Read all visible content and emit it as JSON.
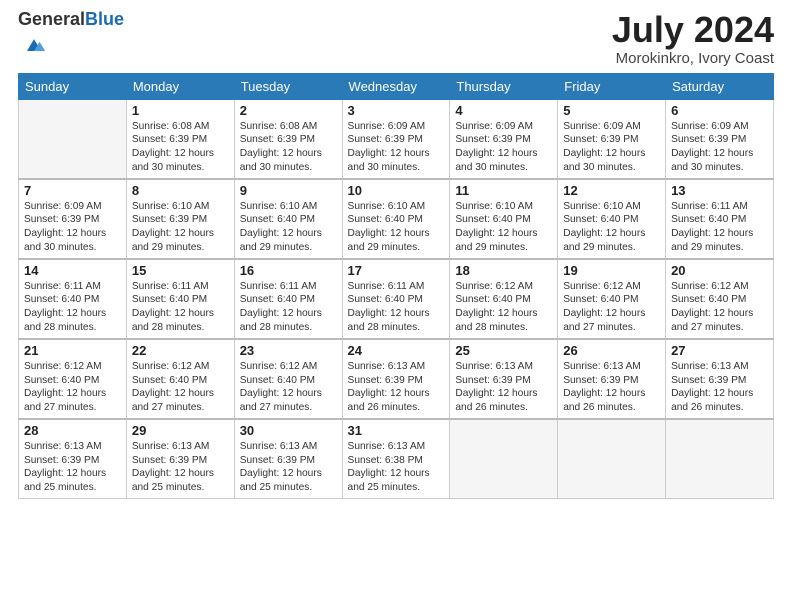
{
  "header": {
    "logo_general": "General",
    "logo_blue": "Blue",
    "month_year": "July 2024",
    "location": "Morokinkro, Ivory Coast"
  },
  "days_of_week": [
    "Sunday",
    "Monday",
    "Tuesday",
    "Wednesday",
    "Thursday",
    "Friday",
    "Saturday"
  ],
  "weeks": [
    [
      {
        "day": "",
        "info": ""
      },
      {
        "day": "1",
        "info": "Sunrise: 6:08 AM\nSunset: 6:39 PM\nDaylight: 12 hours\nand 30 minutes."
      },
      {
        "day": "2",
        "info": "Sunrise: 6:08 AM\nSunset: 6:39 PM\nDaylight: 12 hours\nand 30 minutes."
      },
      {
        "day": "3",
        "info": "Sunrise: 6:09 AM\nSunset: 6:39 PM\nDaylight: 12 hours\nand 30 minutes."
      },
      {
        "day": "4",
        "info": "Sunrise: 6:09 AM\nSunset: 6:39 PM\nDaylight: 12 hours\nand 30 minutes."
      },
      {
        "day": "5",
        "info": "Sunrise: 6:09 AM\nSunset: 6:39 PM\nDaylight: 12 hours\nand 30 minutes."
      },
      {
        "day": "6",
        "info": "Sunrise: 6:09 AM\nSunset: 6:39 PM\nDaylight: 12 hours\nand 30 minutes."
      }
    ],
    [
      {
        "day": "7",
        "info": ""
      },
      {
        "day": "8",
        "info": "Sunrise: 6:10 AM\nSunset: 6:39 PM\nDaylight: 12 hours\nand 29 minutes."
      },
      {
        "day": "9",
        "info": "Sunrise: 6:10 AM\nSunset: 6:40 PM\nDaylight: 12 hours\nand 29 minutes."
      },
      {
        "day": "10",
        "info": "Sunrise: 6:10 AM\nSunset: 6:40 PM\nDaylight: 12 hours\nand 29 minutes."
      },
      {
        "day": "11",
        "info": "Sunrise: 6:10 AM\nSunset: 6:40 PM\nDaylight: 12 hours\nand 29 minutes."
      },
      {
        "day": "12",
        "info": "Sunrise: 6:10 AM\nSunset: 6:40 PM\nDaylight: 12 hours\nand 29 minutes."
      },
      {
        "day": "13",
        "info": "Sunrise: 6:11 AM\nSunset: 6:40 PM\nDaylight: 12 hours\nand 29 minutes."
      }
    ],
    [
      {
        "day": "14",
        "info": "Sunrise: 6:11 AM\nSunset: 6:40 PM\nDaylight: 12 hours\nand 28 minutes."
      },
      {
        "day": "15",
        "info": "Sunrise: 6:11 AM\nSunset: 6:40 PM\nDaylight: 12 hours\nand 28 minutes."
      },
      {
        "day": "16",
        "info": "Sunrise: 6:11 AM\nSunset: 6:40 PM\nDaylight: 12 hours\nand 28 minutes."
      },
      {
        "day": "17",
        "info": "Sunrise: 6:11 AM\nSunset: 6:40 PM\nDaylight: 12 hours\nand 28 minutes."
      },
      {
        "day": "18",
        "info": "Sunrise: 6:12 AM\nSunset: 6:40 PM\nDaylight: 12 hours\nand 28 minutes."
      },
      {
        "day": "19",
        "info": "Sunrise: 6:12 AM\nSunset: 6:40 PM\nDaylight: 12 hours\nand 27 minutes."
      },
      {
        "day": "20",
        "info": "Sunrise: 6:12 AM\nSunset: 6:40 PM\nDaylight: 12 hours\nand 27 minutes."
      }
    ],
    [
      {
        "day": "21",
        "info": "Sunrise: 6:12 AM\nSunset: 6:40 PM\nDaylight: 12 hours\nand 27 minutes."
      },
      {
        "day": "22",
        "info": "Sunrise: 6:12 AM\nSunset: 6:40 PM\nDaylight: 12 hours\nand 27 minutes."
      },
      {
        "day": "23",
        "info": "Sunrise: 6:12 AM\nSunset: 6:40 PM\nDaylight: 12 hours\nand 27 minutes."
      },
      {
        "day": "24",
        "info": "Sunrise: 6:13 AM\nSunset: 6:39 PM\nDaylight: 12 hours\nand 26 minutes."
      },
      {
        "day": "25",
        "info": "Sunrise: 6:13 AM\nSunset: 6:39 PM\nDaylight: 12 hours\nand 26 minutes."
      },
      {
        "day": "26",
        "info": "Sunrise: 6:13 AM\nSunset: 6:39 PM\nDaylight: 12 hours\nand 26 minutes."
      },
      {
        "day": "27",
        "info": "Sunrise: 6:13 AM\nSunset: 6:39 PM\nDaylight: 12 hours\nand 26 minutes."
      }
    ],
    [
      {
        "day": "28",
        "info": "Sunrise: 6:13 AM\nSunset: 6:39 PM\nDaylight: 12 hours\nand 25 minutes."
      },
      {
        "day": "29",
        "info": "Sunrise: 6:13 AM\nSunset: 6:39 PM\nDaylight: 12 hours\nand 25 minutes."
      },
      {
        "day": "30",
        "info": "Sunrise: 6:13 AM\nSunset: 6:39 PM\nDaylight: 12 hours\nand 25 minutes."
      },
      {
        "day": "31",
        "info": "Sunrise: 6:13 AM\nSunset: 6:38 PM\nDaylight: 12 hours\nand 25 minutes."
      },
      {
        "day": "",
        "info": ""
      },
      {
        "day": "",
        "info": ""
      },
      {
        "day": "",
        "info": ""
      }
    ]
  ],
  "week7_sun_info": "Sunrise: 6:09 AM\nSunset: 6:39 PM\nDaylight: 12 hours\nand 30 minutes."
}
